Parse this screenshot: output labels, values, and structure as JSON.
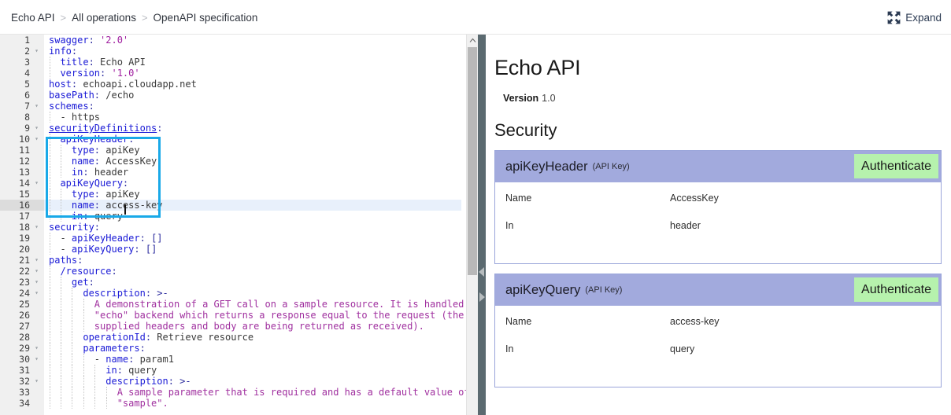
{
  "topbar": {
    "breadcrumb": [
      {
        "label": "Echo API",
        "link": true
      },
      {
        "label": "All operations",
        "link": true
      },
      {
        "label": "OpenAPI specification",
        "link": false
      }
    ],
    "separator": ">",
    "expand_label": "Expand",
    "expand_icon": "expand-arrows-icon"
  },
  "editor": {
    "language": "yaml",
    "active_line": 16,
    "cursor": {
      "line": 16,
      "column": 19
    },
    "scrollbar": {
      "up_icon": "chevron-up-icon"
    },
    "lines": [
      {
        "n": 1,
        "fold": "",
        "indent": 0,
        "tokens": [
          {
            "t": "swagger",
            "c": "key"
          },
          {
            "t": ": ",
            "c": "punct"
          },
          {
            "t": "'2.0'",
            "c": "str"
          }
        ]
      },
      {
        "n": 2,
        "fold": "▾",
        "indent": 0,
        "tokens": [
          {
            "t": "info",
            "c": "key"
          },
          {
            "t": ":",
            "c": "punct"
          }
        ]
      },
      {
        "n": 3,
        "fold": "",
        "indent": 1,
        "tokens": [
          {
            "t": "  title",
            "c": "key"
          },
          {
            "t": ": ",
            "c": "punct"
          },
          {
            "t": "Echo API",
            "c": "val"
          }
        ]
      },
      {
        "n": 4,
        "fold": "",
        "indent": 1,
        "tokens": [
          {
            "t": "  version",
            "c": "key"
          },
          {
            "t": ": ",
            "c": "punct"
          },
          {
            "t": "'1.0'",
            "c": "str"
          }
        ]
      },
      {
        "n": 5,
        "fold": "",
        "indent": 0,
        "tokens": [
          {
            "t": "host",
            "c": "key"
          },
          {
            "t": ": ",
            "c": "punct"
          },
          {
            "t": "echoapi.cloudapp.net",
            "c": "val"
          }
        ]
      },
      {
        "n": 6,
        "fold": "",
        "indent": 0,
        "tokens": [
          {
            "t": "basePath",
            "c": "key"
          },
          {
            "t": ": ",
            "c": "punct"
          },
          {
            "t": "/echo",
            "c": "val"
          }
        ]
      },
      {
        "n": 7,
        "fold": "▾",
        "indent": 0,
        "tokens": [
          {
            "t": "schemes",
            "c": "key"
          },
          {
            "t": ":",
            "c": "punct"
          }
        ]
      },
      {
        "n": 8,
        "fold": "",
        "indent": 1,
        "tokens": [
          {
            "t": "  - ",
            "c": "dash"
          },
          {
            "t": "https",
            "c": "val"
          }
        ]
      },
      {
        "n": 9,
        "fold": "▾",
        "indent": 0,
        "tokens": [
          {
            "t": "securityDefinitions",
            "c": "under"
          },
          {
            "t": ":",
            "c": "punct"
          }
        ]
      },
      {
        "n": 10,
        "fold": "▾",
        "indent": 1,
        "tokens": [
          {
            "t": "  apiKeyHeader",
            "c": "key"
          },
          {
            "t": ":",
            "c": "punct"
          }
        ]
      },
      {
        "n": 11,
        "fold": "",
        "indent": 2,
        "tokens": [
          {
            "t": "    type",
            "c": "key"
          },
          {
            "t": ": ",
            "c": "punct"
          },
          {
            "t": "apiKey",
            "c": "val"
          }
        ]
      },
      {
        "n": 12,
        "fold": "",
        "indent": 2,
        "tokens": [
          {
            "t": "    name",
            "c": "key"
          },
          {
            "t": ": ",
            "c": "punct"
          },
          {
            "t": "AccessKey",
            "c": "val"
          }
        ]
      },
      {
        "n": 13,
        "fold": "",
        "indent": 2,
        "tokens": [
          {
            "t": "    in",
            "c": "key"
          },
          {
            "t": ": ",
            "c": "punct"
          },
          {
            "t": "header",
            "c": "val"
          }
        ]
      },
      {
        "n": 14,
        "fold": "▾",
        "indent": 1,
        "tokens": [
          {
            "t": "  apiKeyQuery",
            "c": "key"
          },
          {
            "t": ":",
            "c": "punct"
          }
        ]
      },
      {
        "n": 15,
        "fold": "",
        "indent": 2,
        "tokens": [
          {
            "t": "    type",
            "c": "key"
          },
          {
            "t": ": ",
            "c": "punct"
          },
          {
            "t": "apiKey",
            "c": "val"
          }
        ]
      },
      {
        "n": 16,
        "fold": "",
        "indent": 2,
        "tokens": [
          {
            "t": "    name",
            "c": "key"
          },
          {
            "t": ": ",
            "c": "punct"
          },
          {
            "t": "access-key",
            "c": "val"
          }
        ]
      },
      {
        "n": 17,
        "fold": "",
        "indent": 2,
        "tokens": [
          {
            "t": "    in",
            "c": "key"
          },
          {
            "t": ": ",
            "c": "punct"
          },
          {
            "t": "query",
            "c": "val"
          }
        ]
      },
      {
        "n": 18,
        "fold": "▾",
        "indent": 0,
        "tokens": [
          {
            "t": "security",
            "c": "key"
          },
          {
            "t": ":",
            "c": "punct"
          }
        ]
      },
      {
        "n": 19,
        "fold": "",
        "indent": 1,
        "tokens": [
          {
            "t": "  - ",
            "c": "dash"
          },
          {
            "t": "apiKeyHeader",
            "c": "key"
          },
          {
            "t": ": ",
            "c": "punct"
          },
          {
            "t": "[]",
            "c": "punct"
          }
        ]
      },
      {
        "n": 20,
        "fold": "",
        "indent": 1,
        "tokens": [
          {
            "t": "  - ",
            "c": "dash"
          },
          {
            "t": "apiKeyQuery",
            "c": "key"
          },
          {
            "t": ": ",
            "c": "punct"
          },
          {
            "t": "[]",
            "c": "punct"
          }
        ]
      },
      {
        "n": 21,
        "fold": "▾",
        "indent": 0,
        "tokens": [
          {
            "t": "paths",
            "c": "key"
          },
          {
            "t": ":",
            "c": "punct"
          }
        ]
      },
      {
        "n": 22,
        "fold": "▾",
        "indent": 1,
        "tokens": [
          {
            "t": "  /resource",
            "c": "key"
          },
          {
            "t": ":",
            "c": "punct"
          }
        ]
      },
      {
        "n": 23,
        "fold": "▾",
        "indent": 2,
        "tokens": [
          {
            "t": "    get",
            "c": "key"
          },
          {
            "t": ":",
            "c": "punct"
          }
        ]
      },
      {
        "n": 24,
        "fold": "▾",
        "indent": 3,
        "tokens": [
          {
            "t": "      description",
            "c": "key"
          },
          {
            "t": ": ",
            "c": "punct"
          },
          {
            "t": ">-",
            "c": "punct"
          }
        ]
      },
      {
        "n": 25,
        "fold": "",
        "indent": 4,
        "tokens": [
          {
            "t": "        A demonstration of a GET call on a sample resource. It is handled by an",
            "c": "text"
          }
        ]
      },
      {
        "n": 26,
        "fold": "",
        "indent": 4,
        "tokens": [
          {
            "t": "        \"echo\" backend which returns a response equal to the request (the",
            "c": "text"
          }
        ]
      },
      {
        "n": 27,
        "fold": "",
        "indent": 4,
        "tokens": [
          {
            "t": "        supplied headers and body are being returned as received).",
            "c": "text"
          }
        ]
      },
      {
        "n": 28,
        "fold": "",
        "indent": 3,
        "tokens": [
          {
            "t": "      operationId",
            "c": "key"
          },
          {
            "t": ": ",
            "c": "punct"
          },
          {
            "t": "Retrieve resource",
            "c": "val"
          }
        ]
      },
      {
        "n": 29,
        "fold": "▾",
        "indent": 3,
        "tokens": [
          {
            "t": "      parameters",
            "c": "key"
          },
          {
            "t": ":",
            "c": "punct"
          }
        ]
      },
      {
        "n": 30,
        "fold": "▾",
        "indent": 4,
        "tokens": [
          {
            "t": "        - ",
            "c": "dash"
          },
          {
            "t": "name",
            "c": "key"
          },
          {
            "t": ": ",
            "c": "punct"
          },
          {
            "t": "param1",
            "c": "val"
          }
        ]
      },
      {
        "n": 31,
        "fold": "",
        "indent": 5,
        "tokens": [
          {
            "t": "          in",
            "c": "key"
          },
          {
            "t": ": ",
            "c": "punct"
          },
          {
            "t": "query",
            "c": "val"
          }
        ]
      },
      {
        "n": 32,
        "fold": "▾",
        "indent": 5,
        "tokens": [
          {
            "t": "          description",
            "c": "key"
          },
          {
            "t": ": ",
            "c": "punct"
          },
          {
            "t": ">-",
            "c": "punct"
          }
        ]
      },
      {
        "n": 33,
        "fold": "",
        "indent": 6,
        "tokens": [
          {
            "t": "            A sample parameter that is required and has a default value of",
            "c": "text"
          }
        ]
      },
      {
        "n": 34,
        "fold": "",
        "indent": 6,
        "tokens": [
          {
            "t": "            \"sample\".",
            "c": "text"
          }
        ]
      }
    ]
  },
  "splitter": {
    "collapse_icon": "triangle-left-icon",
    "expand_icon": "triangle-right-icon"
  },
  "doc": {
    "title": "Echo API",
    "version_label": "Version",
    "version_value": "1.0",
    "security_heading": "Security",
    "schemes": [
      {
        "name": "apiKeyHeader",
        "type": "(API Key)",
        "action_label": "Authenticate",
        "rows": [
          {
            "key": "Name",
            "value": "AccessKey"
          },
          {
            "key": "In",
            "value": "header"
          }
        ]
      },
      {
        "name": "apiKeyQuery",
        "type": "(API Key)",
        "action_label": "Authenticate",
        "rows": [
          {
            "key": "Name",
            "value": "access-key"
          },
          {
            "key": "In",
            "value": "query"
          }
        ]
      }
    ]
  },
  "colors": {
    "highlight_box": "#19a9e8",
    "card_header": "#a2aadd",
    "card_border": "#9aa5da",
    "auth_button": "#b6f2ad",
    "splitter": "#5b6a70",
    "gutter": "#f0f0f0",
    "active_line": "#e8f0fb",
    "yaml_key": "#1a1ad6",
    "yaml_string": "#a020a0",
    "yaml_text": "#a0309f"
  }
}
